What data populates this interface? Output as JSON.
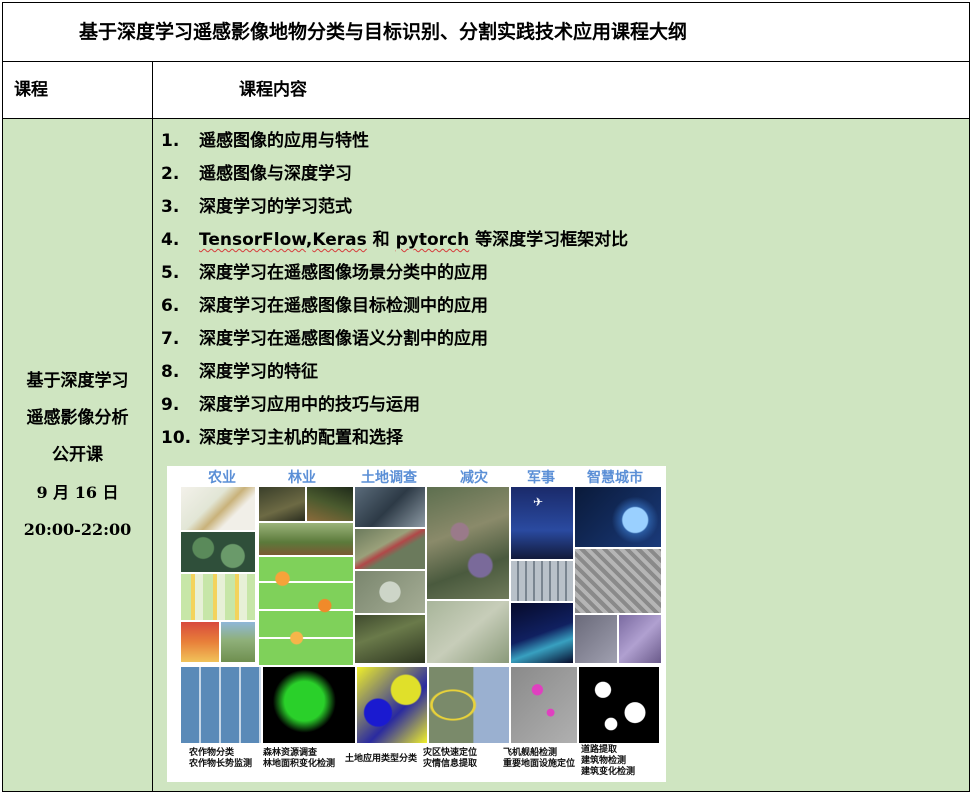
{
  "title": "基于深度学习遥感影像地物分类与目标识别、分割实践技术应用课程大纲",
  "header": {
    "course_label": "课程",
    "content_label": "课程内容"
  },
  "course": {
    "name_line1": "基于深度学习",
    "name_line2": "遥感影像分析",
    "name_line3": "公开课",
    "date": "9 月 16 日",
    "time": "20:00-22:00"
  },
  "topics": [
    {
      "num": "1.",
      "text": "遥感图像的应用与特性"
    },
    {
      "num": "2.",
      "text": "遥感图像与深度学习"
    },
    {
      "num": "3.",
      "text": "深度学习的学习范式"
    },
    {
      "num": "4.",
      "text_parts": [
        "TensorFlow",
        ",",
        "Keras",
        " 和 ",
        "pytorch",
        " 等深度学习框架对比"
      ]
    },
    {
      "num": "5.",
      "text": "深度学习在遥感图像场景分类中的应用"
    },
    {
      "num": "6.",
      "text": "深度学习在遥感图像目标检测中的应用"
    },
    {
      "num": "7.",
      "text": "深度学习在遥感图像语义分割中的应用"
    },
    {
      "num": "8.",
      "text": "深度学习的特征"
    },
    {
      "num": "9.",
      "text": "深度学习应用中的技巧与运用"
    },
    {
      "num": "10.",
      "text": "深度学习主机的配置和选择"
    }
  ],
  "collage": {
    "categories": [
      "农业",
      "林业",
      "土地调查",
      "减灾",
      "军事",
      "智慧城市"
    ],
    "captions": [
      [
        "农作物分类",
        "农作物长势监测"
      ],
      [
        "森林资源调查",
        "林地面积变化检测"
      ],
      [
        "土地应用类型分类"
      ],
      [
        "灾区快速定位",
        "灾情信息提取"
      ],
      [
        "飞机舰船检测",
        "重要地面设施定位"
      ],
      [
        "道路提取",
        "建筑物检测",
        "建筑变化检测"
      ]
    ],
    "category_color": "#5b8fd6"
  },
  "colors": {
    "body_bg": "#cfe5c1",
    "border": "#000000",
    "spellcheck": "#d63b3b"
  }
}
